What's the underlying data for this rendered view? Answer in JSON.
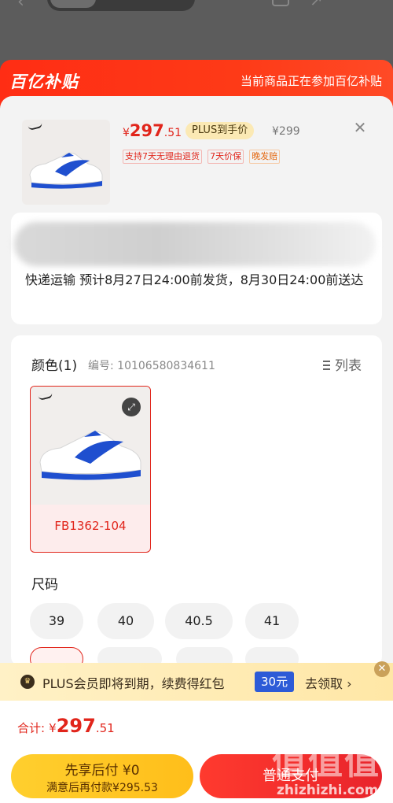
{
  "banner": {
    "logo_text": "百亿补贴",
    "note": "当前商品正在参加百亿补贴"
  },
  "product": {
    "brand_icon": "nike-swoosh-icon",
    "price": {
      "yen": "¥",
      "integer": "297",
      "decimal": ".51"
    },
    "plus_tag": "PLUS到手价",
    "original_price": "¥299",
    "tags": [
      "支持7天无理由退货",
      "7天价保",
      "晚发赔"
    ]
  },
  "delivery": {
    "text": "快递运输 预计8月27日24:00前发货，8月30日24:00前送达"
  },
  "spec": {
    "color_title": "颜色(1)",
    "color_code": "编号: 10106580834611",
    "list_label": "列表",
    "variants": [
      {
        "code": "FB1362-104",
        "selected": true
      }
    ],
    "size_title": "尺码",
    "sizes": [
      "39",
      "40",
      "40.5",
      "41"
    ]
  },
  "plus_bar": {
    "message": "PLUS会员即将到期，续费得红包",
    "coupon": "30元",
    "action": "去领取 ›"
  },
  "footer": {
    "total_label": "合计:",
    "total": {
      "yen": "¥",
      "integer": "297",
      "decimal": ".51"
    },
    "pay_later": {
      "line1": "先享后付 ¥0",
      "line2": "满意后再付款¥295.53"
    },
    "normal_pay": "普通支付"
  },
  "watermark": {
    "top": "值值值",
    "bottom": "zhizhizhi.com"
  },
  "colors": {
    "accent": "#e1251b",
    "banner": "#ff2d14",
    "plus_gold": "#ffcf2e",
    "coupon_blue": "#2d5bd7"
  }
}
